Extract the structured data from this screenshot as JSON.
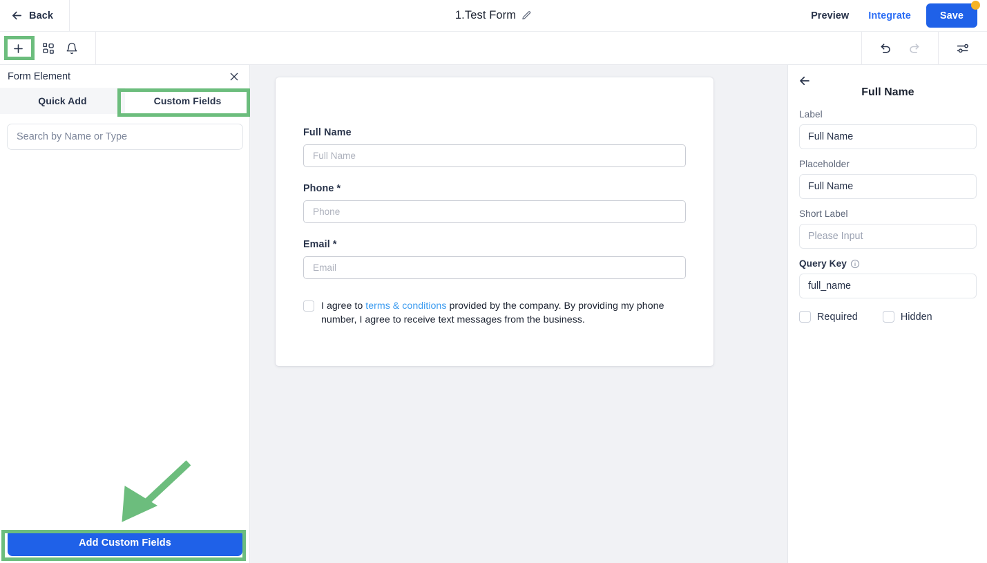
{
  "header": {
    "back_label": "Back",
    "back_icon": "arrow-left-icon",
    "form_title": "1.Test Form",
    "edit_icon": "pencil-icon",
    "preview_label": "Preview",
    "integrate_label": "Integrate",
    "save_label": "Save",
    "save_badge_color": "#f5b324",
    "accent_blue": "#1f61e8",
    "link_blue": "#2c6ef5"
  },
  "toolbar": {
    "left_icons": [
      {
        "name": "plus-icon",
        "label": "+"
      },
      {
        "name": "layout-blocks-icon",
        "label": ""
      },
      {
        "name": "bell-icon",
        "label": ""
      }
    ],
    "right_icons": [
      {
        "name": "undo-icon",
        "state": "enabled"
      },
      {
        "name": "redo-icon",
        "state": "disabled"
      },
      {
        "name": "settings-sliders-icon",
        "state": "enabled"
      }
    ]
  },
  "left_panel": {
    "title": "Form Element",
    "close_icon": "close-icon",
    "tabs": [
      {
        "label": "Quick Add",
        "active": false
      },
      {
        "label": "Custom Fields",
        "active": true
      }
    ],
    "search": {
      "value": "",
      "placeholder": "Search by Name or Type"
    },
    "add_button_label": "Add Custom Fields"
  },
  "canvas": {
    "background": "#f1f2f5",
    "fields": [
      {
        "label": "Full Name",
        "required": false,
        "value": "",
        "placeholder": "Full Name"
      },
      {
        "label": "Phone",
        "required": true,
        "value": "",
        "placeholder": "Phone"
      },
      {
        "label": "Email",
        "required": true,
        "value": "",
        "placeholder": "Email"
      }
    ],
    "required_marker": "*",
    "consent": {
      "checked": false,
      "text_before": "I agree to ",
      "link_text": "terms & conditions",
      "text_after": " provided by the company. By providing my phone number, I agree to receive text messages from the business."
    }
  },
  "right_panel": {
    "back_icon": "arrow-left-icon",
    "title": "Full Name",
    "fields": [
      {
        "label": "Label",
        "value": "Full Name",
        "placeholder": "",
        "bold_label": false
      },
      {
        "label": "Placeholder",
        "value": "Full Name",
        "placeholder": "",
        "bold_label": false
      },
      {
        "label": "Short Label",
        "value": "",
        "placeholder": "Please Input",
        "bold_label": false
      },
      {
        "label": "Query Key",
        "value": "full_name",
        "placeholder": "",
        "bold_label": true,
        "info_icon": "info-circle-icon"
      }
    ],
    "checkboxes": [
      {
        "label": "Required",
        "checked": false
      },
      {
        "label": "Hidden",
        "checked": false
      }
    ]
  },
  "annotations": {
    "highlight_color": "#6cbd7d",
    "arrow_icon": "annotation-arrow-icon",
    "highlights": [
      "plus-toolbar-button",
      "custom-fields-tab",
      "add-custom-fields-button"
    ]
  }
}
